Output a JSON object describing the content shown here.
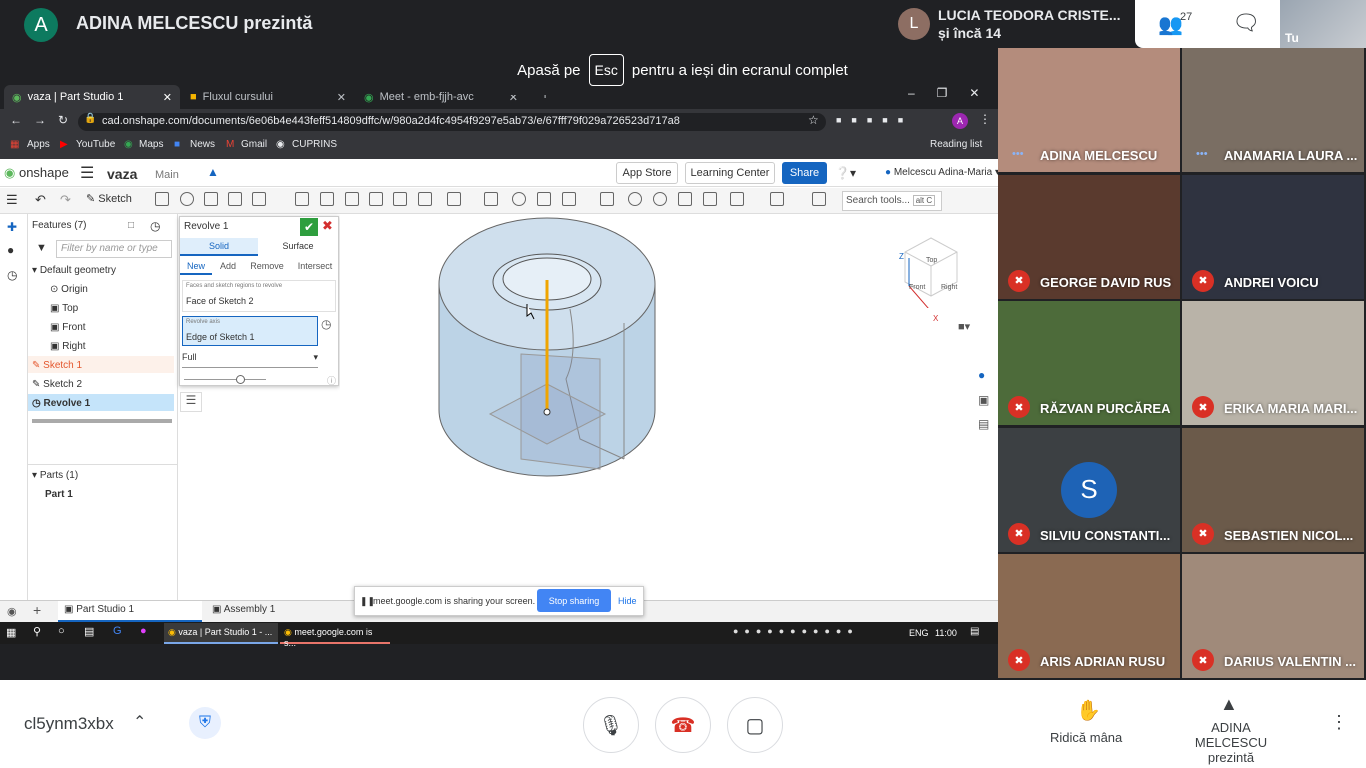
{
  "meet": {
    "presenter_initial": "A",
    "presenter_title": "ADINA MELCESCU prezintă",
    "fullscreen_prefix": "Apasă pe",
    "fullscreen_key": "Esc",
    "fullscreen_suffix": "pentru a ieși din ecranul complet",
    "pinned_initial": "L",
    "pinned_name": "LUCIA TEODORA CRISTE...",
    "pinned_more": "și încă 14",
    "people_count": "27",
    "self_label": "Tu",
    "meeting_code": "cl5ynm3xbx",
    "raise_hand": "Ridică mâna",
    "presenting_line1": "ADINA MELCESCU",
    "presenting_line2": "prezintă",
    "participants": [
      {
        "name": "ADINA MELCESCU",
        "muted": false,
        "bg": "#b48c7c"
      },
      {
        "name": "ANAMARIA LAURA ...",
        "muted": false,
        "bg": "#7a6e63"
      },
      {
        "name": "GEORGE DAVID RUS",
        "muted": true,
        "bg": "#5a3a2e"
      },
      {
        "name": "ANDREI VOICU",
        "muted": true,
        "bg": "#2f3340"
      },
      {
        "name": "RĂZVAN PURCĂREA",
        "muted": true,
        "bg": "#4d6b3a"
      },
      {
        "name": "ERIKA MARIA MARI...",
        "muted": true,
        "bg": "#b9b3a8"
      },
      {
        "name": "SILVIU CONSTANTI...",
        "muted": true,
        "bg": "#3c4043",
        "initial": "S"
      },
      {
        "name": "SEBASTIEN NICOL...",
        "muted": true,
        "bg": "#6b5a4a"
      },
      {
        "name": "ARIS ADRIAN RUSU",
        "muted": true,
        "bg": "#8a6a52"
      },
      {
        "name": "DARIUS VALENTIN ...",
        "muted": true,
        "bg": "#a08a7a"
      }
    ],
    "share_notice": "meet.google.com is sharing your screen.",
    "stop_sharing": "Stop sharing",
    "hide": "Hide"
  },
  "browser": {
    "tabs": [
      "vaza | Part Studio 1",
      "Fluxul cursului",
      "Meet - emb-fjjh-avc"
    ],
    "url": "cad.onshape.com/documents/6e06b4e443feff514809dffc/w/980a2d4fc4954f9297e5ab73/e/67fff79f029a726523d717a8",
    "bookmarks": [
      "Apps",
      "YouTube",
      "Maps",
      "News",
      "Gmail",
      "CUPRINS"
    ],
    "reading_list": "Reading list"
  },
  "onshape": {
    "logo": "onshape",
    "doc_name": "vaza",
    "branch": "Main",
    "app_store": "App Store",
    "learning_center": "Learning Center",
    "share": "Share",
    "user": "Melcescu Adina-Maria",
    "sketch": "Sketch",
    "search_tools": "Search tools...",
    "search_shortcut": "alt C",
    "features_header": "Features (7)",
    "filter_placeholder": "Filter by name or type",
    "default_geometry": "Default geometry",
    "origin": "Origin",
    "top": "Top",
    "front": "Front",
    "right": "Right",
    "sketch1": "Sketch 1",
    "sketch2": "Sketch 2",
    "revolve1": "Revolve 1",
    "parts_header": "Parts (1)",
    "part1": "Part 1",
    "tab_part_studio": "Part Studio 1",
    "tab_assembly": "Assembly 1"
  },
  "dialog": {
    "title": "Revolve 1",
    "type_solid": "Solid",
    "type_surface": "Surface",
    "op_new": "New",
    "op_add": "Add",
    "op_remove": "Remove",
    "op_intersect": "Intersect",
    "faces_label": "Faces and sketch regions to revolve",
    "faces_value": "Face of Sketch 2",
    "axis_label": "Revolve axis",
    "axis_value": "Edge of Sketch 1",
    "revolve_type": "Full"
  },
  "viewcube": {
    "top": "Top",
    "front": "Front",
    "right": "Right",
    "axis_z": "Z",
    "axis_x": "X"
  },
  "taskbar": {
    "item1": "vaza | Part Studio 1 - ...",
    "item2": "meet.google.com is s...",
    "lang": "ENG",
    "time": "11:00"
  }
}
